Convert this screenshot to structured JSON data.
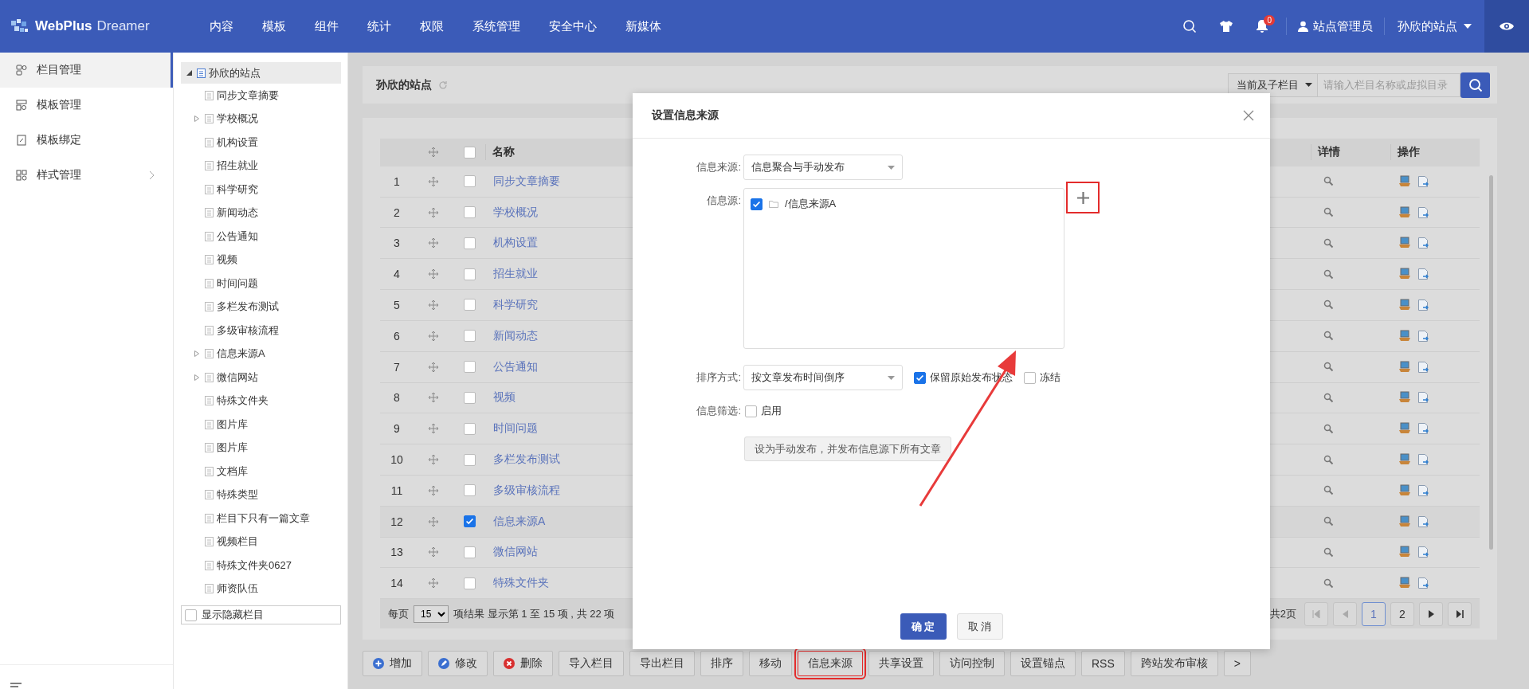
{
  "header": {
    "logo_main": "WebPlus",
    "logo_sub": "Dreamer",
    "nav": [
      "内容",
      "模板",
      "组件",
      "统计",
      "权限",
      "系统管理",
      "安全中心",
      "新媒体"
    ],
    "notification_count": "0",
    "user": "站点管理员",
    "site": "孙欣的站点"
  },
  "sidebar": {
    "items": [
      {
        "label": "栏目管理",
        "selected": true,
        "kind": "columns",
        "has_submenu": false
      },
      {
        "label": "模板管理",
        "selected": false,
        "kind": "templates",
        "has_submenu": false
      },
      {
        "label": "模板绑定",
        "selected": false,
        "kind": "binding",
        "has_submenu": false
      },
      {
        "label": "样式管理",
        "selected": false,
        "kind": "styles",
        "has_submenu": true
      }
    ]
  },
  "tree": {
    "root": {
      "label": "孙欣的站点",
      "selected": true,
      "expanded": true,
      "children": [
        {
          "label": "同步文章摘要",
          "kind": "leaf"
        },
        {
          "label": "学校概况",
          "kind": "branch"
        },
        {
          "label": "机构设置",
          "kind": "leaf"
        },
        {
          "label": "招生就业",
          "kind": "leaf"
        },
        {
          "label": "科学研究",
          "kind": "leaf"
        },
        {
          "label": "新闻动态",
          "kind": "leaf"
        },
        {
          "label": "公告通知",
          "kind": "leaf"
        },
        {
          "label": "视频",
          "kind": "leaf"
        },
        {
          "label": "时间问题",
          "kind": "leaf"
        },
        {
          "label": "多栏发布测试",
          "kind": "leaf"
        },
        {
          "label": "多级审核流程",
          "kind": "leaf"
        },
        {
          "label": "信息来源A",
          "kind": "branch"
        },
        {
          "label": "微信网站",
          "kind": "branch"
        },
        {
          "label": "特殊文件夹",
          "kind": "leaf"
        },
        {
          "label": "图片库",
          "kind": "leaf"
        },
        {
          "label": "图片库",
          "kind": "leaf"
        },
        {
          "label": "文档库",
          "kind": "leaf"
        },
        {
          "label": "特殊类型",
          "kind": "leaf"
        },
        {
          "label": "栏目下只有一篇文章",
          "kind": "leaf"
        },
        {
          "label": "视频栏目",
          "kind": "leaf"
        },
        {
          "label": "特殊文件夹0627",
          "kind": "leaf"
        },
        {
          "label": "师资队伍",
          "kind": "leaf"
        }
      ]
    },
    "show_hidden": {
      "label": "显示隐藏栏目",
      "checked": false
    }
  },
  "content": {
    "title": "孙欣的站点",
    "scope": "当前及子栏目",
    "search_placeholder": "请输入栏目名称或虚拟目录",
    "table": {
      "columns": [
        "名称",
        "详情",
        "操作"
      ],
      "select_all_checked": false,
      "rows": [
        {
          "index": "1",
          "name": "同步文章摘要",
          "checked": false
        },
        {
          "index": "2",
          "name": "学校概况",
          "checked": false
        },
        {
          "index": "3",
          "name": "机构设置",
          "checked": false
        },
        {
          "index": "4",
          "name": "招生就业",
          "checked": false
        },
        {
          "index": "5",
          "name": "科学研究",
          "checked": false
        },
        {
          "index": "6",
          "name": "新闻动态",
          "checked": false
        },
        {
          "index": "7",
          "name": "公告通知",
          "checked": false
        },
        {
          "index": "8",
          "name": "视频",
          "checked": false
        },
        {
          "index": "9",
          "name": "时间问题",
          "checked": false
        },
        {
          "index": "10",
          "name": "多栏发布测试",
          "checked": false
        },
        {
          "index": "11",
          "name": "多级审核流程",
          "checked": false
        },
        {
          "index": "12",
          "name": "信息来源A",
          "checked": true
        },
        {
          "index": "13",
          "name": "微信网站",
          "checked": false
        },
        {
          "index": "14",
          "name": "特殊文件夹",
          "checked": false
        }
      ]
    },
    "pagination": {
      "per_page_label": "每页",
      "per_page": "15",
      "summary": "项结果 显示第 1 至 15 项 , 共 22 项",
      "total_pages": "共2页",
      "pages": [
        {
          "label": "1",
          "selected": true
        },
        {
          "label": "2",
          "selected": false
        }
      ]
    },
    "actions": [
      {
        "label": "增加",
        "kind": "add",
        "highlighted": false
      },
      {
        "label": "修改",
        "kind": "edit",
        "highlighted": false
      },
      {
        "label": "删除",
        "kind": "delete",
        "highlighted": false
      },
      {
        "label": "导入栏目",
        "kind": "plain",
        "highlighted": false
      },
      {
        "label": "导出栏目",
        "kind": "plain",
        "highlighted": false
      },
      {
        "label": "排序",
        "kind": "plain",
        "highlighted": false
      },
      {
        "label": "移动",
        "kind": "plain",
        "highlighted": false
      },
      {
        "label": "信息来源",
        "kind": "plain",
        "highlighted": true
      },
      {
        "label": "共享设置",
        "kind": "plain",
        "highlighted": false
      },
      {
        "label": "访问控制",
        "kind": "plain",
        "highlighted": false
      },
      {
        "label": "设置锚点",
        "kind": "plain",
        "highlighted": false
      },
      {
        "label": "RSS",
        "kind": "plain",
        "highlighted": false
      },
      {
        "label": "跨站发布审核",
        "kind": "plain",
        "highlighted": false
      },
      {
        "label": ">",
        "kind": "plain",
        "highlighted": false
      }
    ]
  },
  "dialog": {
    "title": "设置信息来源",
    "source_label": "信息来源:",
    "source_value": "信息聚合与手动发布",
    "feeds_label": "信息源:",
    "feeds": [
      {
        "path": "/信息来源A",
        "checked": true
      }
    ],
    "add_highlighted": true,
    "sort_label": "排序方式:",
    "sort_value": "按文章发布时间倒序",
    "keep_status": {
      "label": "保留原始发布状态",
      "checked": true
    },
    "freeze": {
      "label": "冻结",
      "checked": false
    },
    "filter_label": "信息筛选:",
    "filter": {
      "label": "启用",
      "checked": false
    },
    "publish_button": "设为手动发布，并发布信息源下所有文章",
    "ok": "确 定",
    "cancel": "取 消"
  }
}
